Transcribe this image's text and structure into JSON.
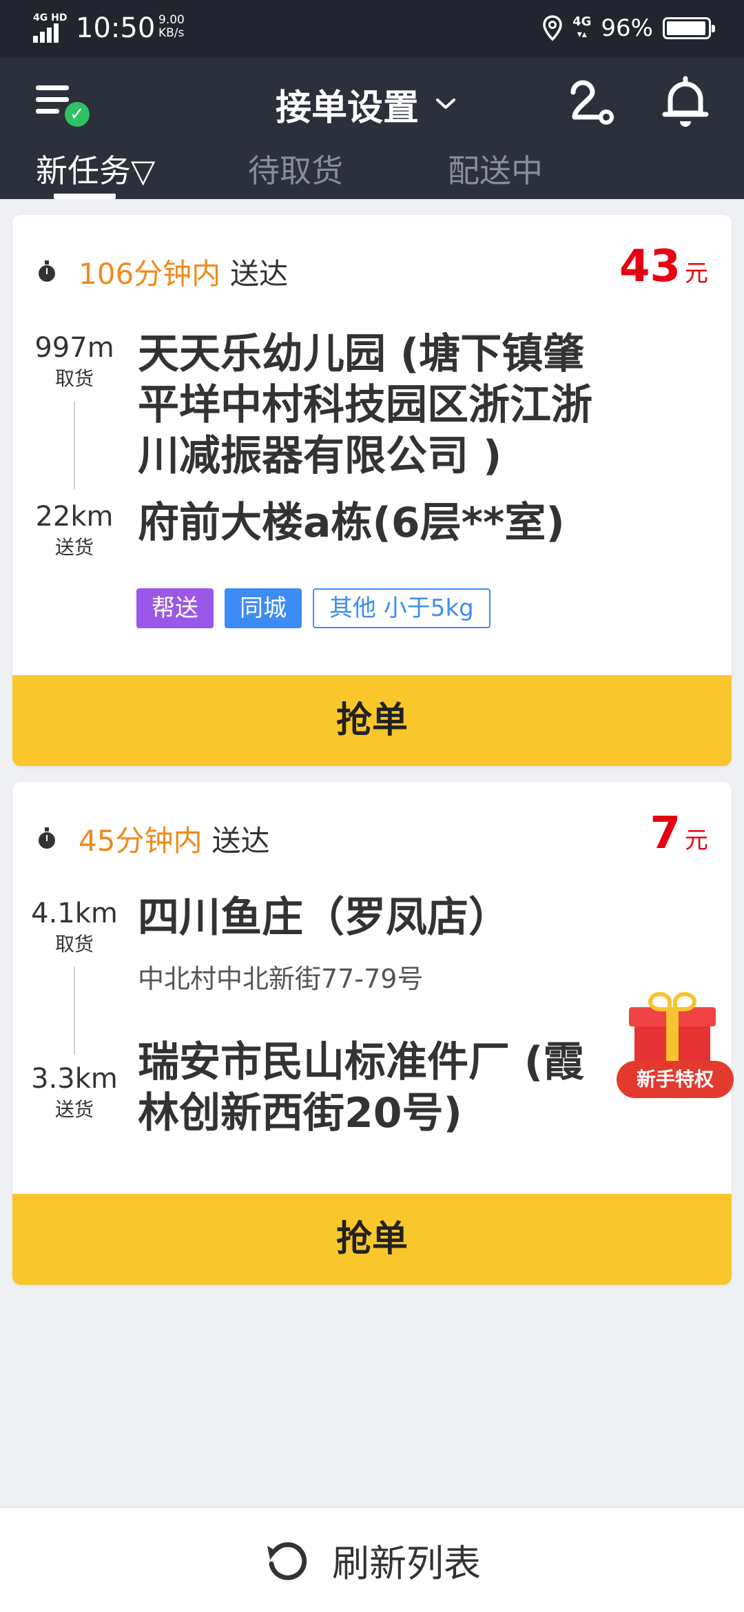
{
  "status_bar": {
    "network": "4G HD",
    "time": "10:50",
    "speed_value": "9.00",
    "speed_unit": "KB/s",
    "signal_4g": "4G",
    "battery": "96%",
    "battery_level": 0.96
  },
  "header": {
    "title": "接单设置",
    "menu_icon": "menu-check-icon",
    "route_icon": "route-icon",
    "bell_icon": "bell-icon"
  },
  "tabs": [
    {
      "label": "新任务▽",
      "active": true
    },
    {
      "label": "待取货",
      "active": false
    },
    {
      "label": "配送中",
      "active": false
    }
  ],
  "orders": [
    {
      "time_minutes": "106分钟内",
      "time_suffix": "送达",
      "price": "43",
      "price_unit": "元",
      "pickup_distance": "997m",
      "pickup_label": "取货",
      "pickup_lines": [
        "天天乐幼儿园 (塘下镇肇",
        "平垟中村科技园区浙江浙",
        "川减振器有限公司 )"
      ],
      "delivery_distance": "22km",
      "delivery_label": "送货",
      "delivery_lines": [
        "府前大楼a栋(6层**室)"
      ],
      "tags": [
        "帮送",
        "同城",
        "其他 小于5kg"
      ],
      "button": "抢单"
    },
    {
      "time_minutes": "45分钟内",
      "time_suffix": "送达",
      "price": "7",
      "price_unit": "元",
      "pickup_distance": "4.1km",
      "pickup_label": "取货",
      "pickup_lines": [
        "四川鱼庄（罗凤店）"
      ],
      "pickup_sub": "中北村中北新街77-79号",
      "delivery_distance": "3.3km",
      "delivery_label": "送货",
      "delivery_lines": [
        "瑞安市民山标准件厂 (霞",
        "林创新西街20号)"
      ],
      "button": "抢单"
    }
  ],
  "gift_badge": {
    "label": "新手特权",
    "icon": "gift-icon"
  },
  "bottom": {
    "label": "刷新列表",
    "icon": "refresh-icon"
  },
  "colors": {
    "header_bg": "#2c303b",
    "status_bg": "#22252d",
    "accent_orange": "#f08a1c",
    "price_red": "#e60012",
    "button_yellow": "#f9c62b",
    "tag_purple": "#9a58e8",
    "tag_blue": "#3d8cf6"
  }
}
